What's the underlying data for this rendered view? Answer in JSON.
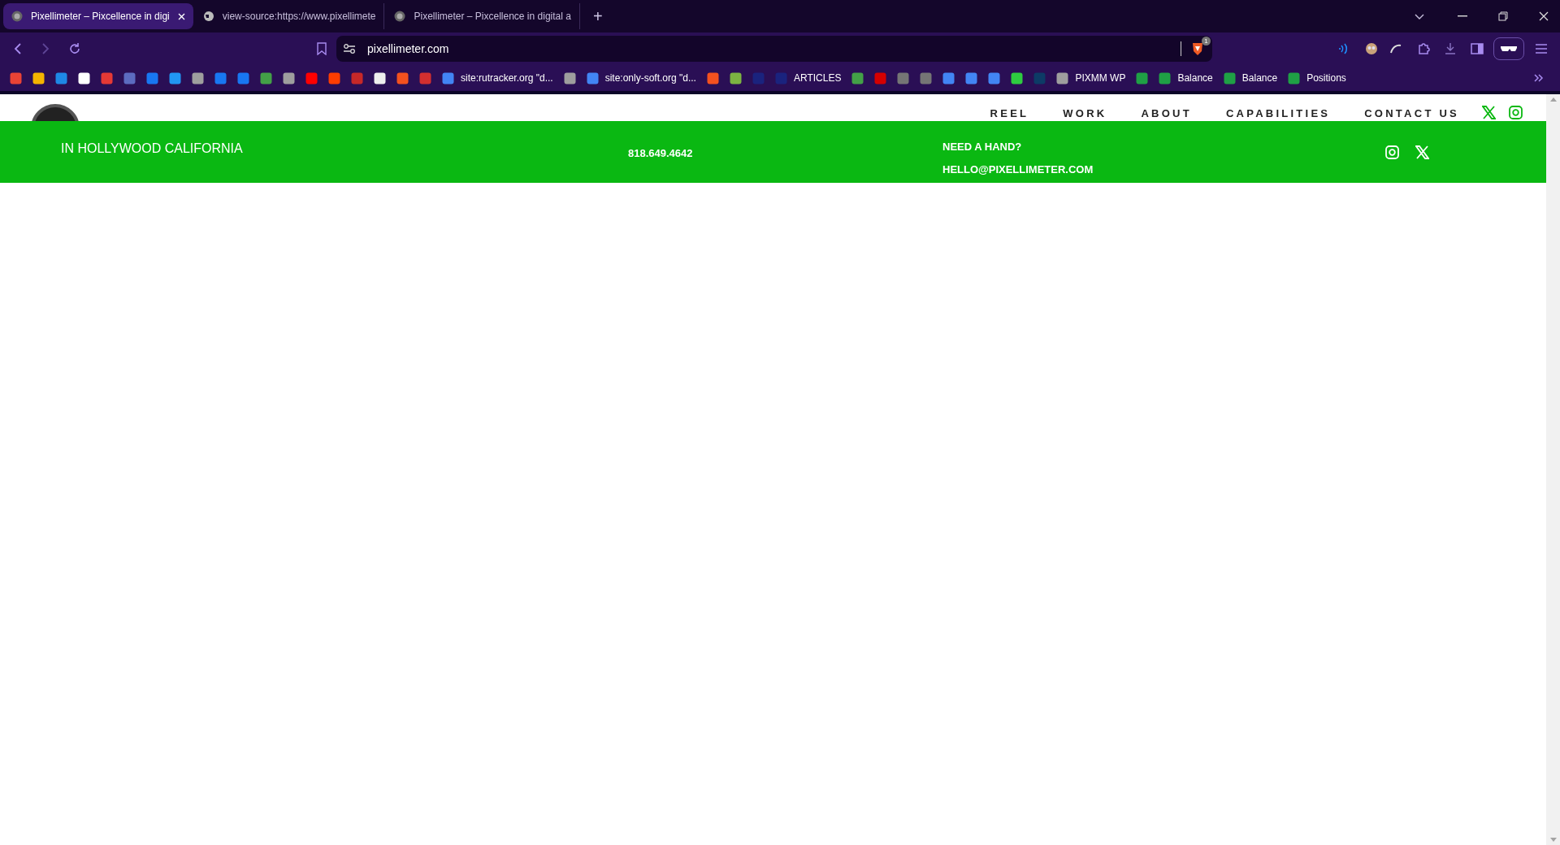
{
  "tabs": [
    {
      "title": "Pixellimeter – Pixcellence in digi",
      "selected": true
    },
    {
      "title": "view-source:https://www.pixellimete",
      "selected": false
    },
    {
      "title": "Pixellimeter – Pixcellence in digital a",
      "selected": false
    }
  ],
  "new_tab": "+",
  "address": {
    "url": "pixellimeter.com",
    "shield_count": "1"
  },
  "bookmarks": [
    {
      "kind": "icon",
      "color": "#ea4335"
    },
    {
      "kind": "icon",
      "color": "#f4b400"
    },
    {
      "kind": "icon",
      "color": "#1e88e5"
    },
    {
      "kind": "icon",
      "color": "#ffffff"
    },
    {
      "kind": "icon",
      "color": "#e53935"
    },
    {
      "kind": "icon",
      "color": "#5c6bc0"
    },
    {
      "kind": "icon",
      "color": "#1877f2"
    },
    {
      "kind": "icon",
      "color": "#2196f3"
    },
    {
      "kind": "icon",
      "color": "#9e9e9e"
    },
    {
      "kind": "icon",
      "color": "#1877f2"
    },
    {
      "kind": "icon",
      "color": "#1877f2"
    },
    {
      "kind": "icon",
      "color": "#43a047"
    },
    {
      "kind": "icon",
      "color": "#9e9e9e"
    },
    {
      "kind": "icon",
      "color": "#ff0000"
    },
    {
      "kind": "icon",
      "color": "#ff3d00"
    },
    {
      "kind": "icon",
      "color": "#c62828"
    },
    {
      "kind": "icon",
      "color": "#eeeeee"
    },
    {
      "kind": "icon",
      "color": "#f4511e"
    },
    {
      "kind": "icon",
      "color": "#d32f2f"
    },
    {
      "kind": "link",
      "label": "site:rutracker.org \"d...",
      "color": "#4285f4"
    },
    {
      "kind": "icon",
      "color": "#9e9e9e"
    },
    {
      "kind": "link",
      "label": "site:only-soft.org \"d...",
      "color": "#4285f4"
    },
    {
      "kind": "icon",
      "color": "#f4511e"
    },
    {
      "kind": "icon",
      "color": "#7cb342"
    },
    {
      "kind": "icon",
      "color": "#1a237e"
    },
    {
      "kind": "link",
      "label": "ARTICLES",
      "color": "#1a237e"
    },
    {
      "kind": "icon",
      "color": "#43a047"
    },
    {
      "kind": "icon",
      "color": "#d50000"
    },
    {
      "kind": "icon",
      "color": "#757575"
    },
    {
      "kind": "icon",
      "color": "#757575"
    },
    {
      "kind": "icon",
      "color": "#4285f4"
    },
    {
      "kind": "icon",
      "color": "#4285f4"
    },
    {
      "kind": "icon",
      "color": "#4285f4"
    },
    {
      "kind": "icon",
      "color": "#2ecc40"
    },
    {
      "kind": "icon",
      "color": "#0d3b66"
    },
    {
      "kind": "link",
      "label": "PIXMM WP",
      "color": "#9e9e9e"
    },
    {
      "kind": "icon",
      "color": "#1fa045"
    },
    {
      "kind": "link",
      "label": "Balance",
      "color": "#1fa045"
    },
    {
      "kind": "link",
      "label": "Balance",
      "color": "#1fa045"
    },
    {
      "kind": "link",
      "label": "Positions",
      "color": "#1fa045"
    }
  ],
  "nav": [
    "REEL",
    "WORK",
    "ABOUT",
    "CAPABILITIES",
    "CONTACT US"
  ],
  "banner": {
    "location": "IN HOLLYWOOD CALIFORNIA",
    "phone": "818.649.4642",
    "help_title": "NEED A HAND?",
    "email": "HELLO@PIXELLIMETER.COM"
  }
}
